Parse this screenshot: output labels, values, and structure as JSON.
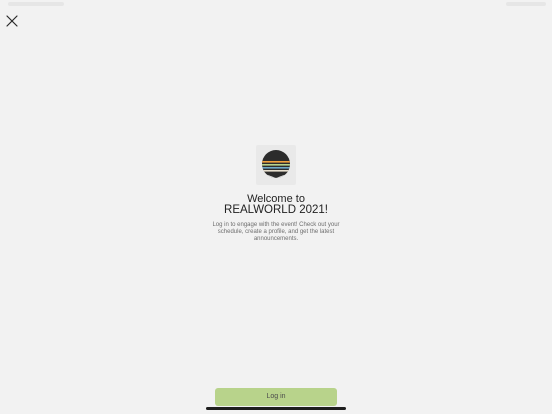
{
  "header": {
    "close_icon": "close-icon"
  },
  "welcome": {
    "logo_icon": "realworld-logo",
    "title_line1": "Welcome to",
    "title_line2": "REALWORLD 2021!",
    "description": "Log in to engage with the event! Check out your schedule, create a profile, and get the latest announcements."
  },
  "actions": {
    "login_label": "Log in"
  },
  "colors": {
    "background": "#f2f2f2",
    "login_button": "#b8d38b",
    "logo_stripes": [
      "#f0a23d",
      "#b8d38b",
      "#6fa9c8",
      "#2c2c2c"
    ]
  }
}
